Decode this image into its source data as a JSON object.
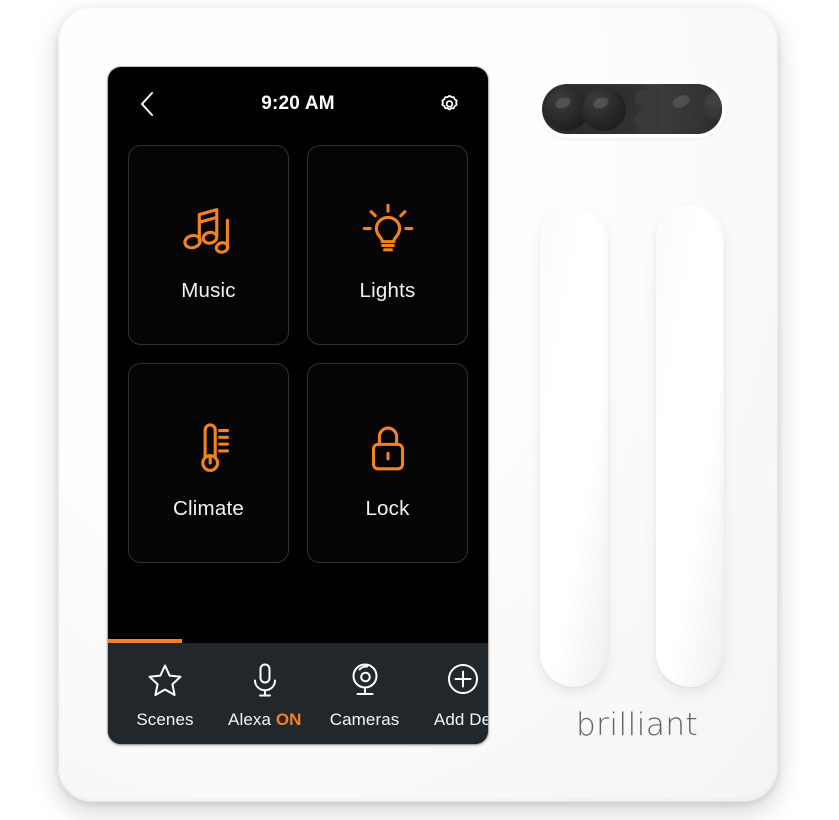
{
  "device": {
    "brand": "brilliant",
    "accent_color": "#f5821f",
    "screen_bg": "#000000",
    "toolbar_bg": "#22272c",
    "tile_border_color": "#2a323d"
  },
  "screen": {
    "statusbar": {
      "back_icon": "chevron-left-icon",
      "time": "9:20 AM",
      "settings_icon": "gear-icon"
    },
    "tiles": [
      {
        "label": "Music",
        "icon": "music-note-icon"
      },
      {
        "label": "Lights",
        "icon": "lightbulb-icon"
      },
      {
        "label": "Climate",
        "icon": "thermometer-icon"
      },
      {
        "label": "Lock",
        "icon": "padlock-icon"
      }
    ],
    "indicator": {
      "fill_percent": 19.5,
      "color": "#f5821f"
    },
    "toolbar": [
      {
        "label": "Scenes",
        "icon": "star-icon",
        "status": ""
      },
      {
        "label": "Alexa ",
        "icon": "mic-icon",
        "status": "ON"
      },
      {
        "label": "Cameras",
        "icon": "webcam-icon",
        "status": ""
      },
      {
        "label": "Add De",
        "icon": "plus-circle-icon",
        "status": ""
      }
    ]
  },
  "hardware": {
    "camera_pill": "camera-module",
    "slider_left": "dimmer-slider-left",
    "slider_right": "dimmer-slider-right"
  }
}
